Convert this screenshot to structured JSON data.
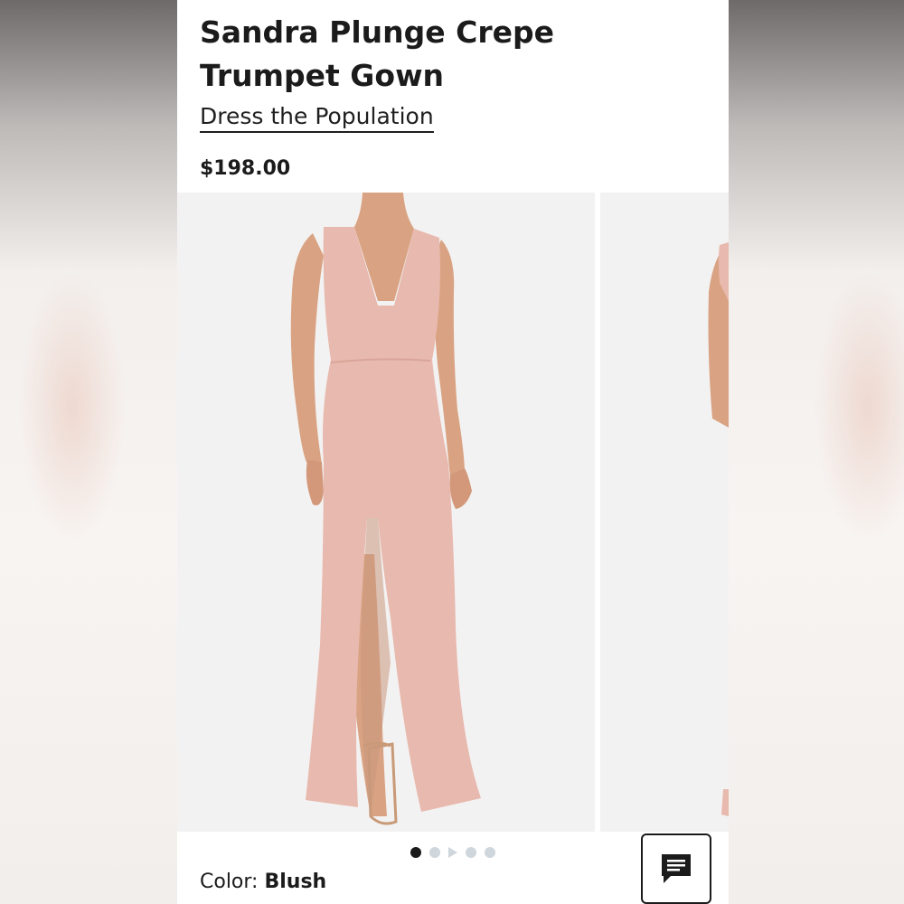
{
  "product": {
    "title": "Sandra Plunge Crepe Trumpet Gown",
    "brand": "Dress the Population",
    "price": "$198.00"
  },
  "gallery": {
    "total_slides": 5,
    "active_index": 0,
    "video_slide_index": 2
  },
  "color": {
    "label": "Color:",
    "value": "Blush"
  },
  "colors": {
    "dress": "#e8b9ae",
    "background": "#f3f2f2",
    "skin": "#d9a383",
    "dot_active": "#1b1b1b",
    "dot_inactive": "#cfd6dc"
  },
  "icons": {
    "chat": "chat-bubble-icon",
    "video": "play-icon"
  }
}
